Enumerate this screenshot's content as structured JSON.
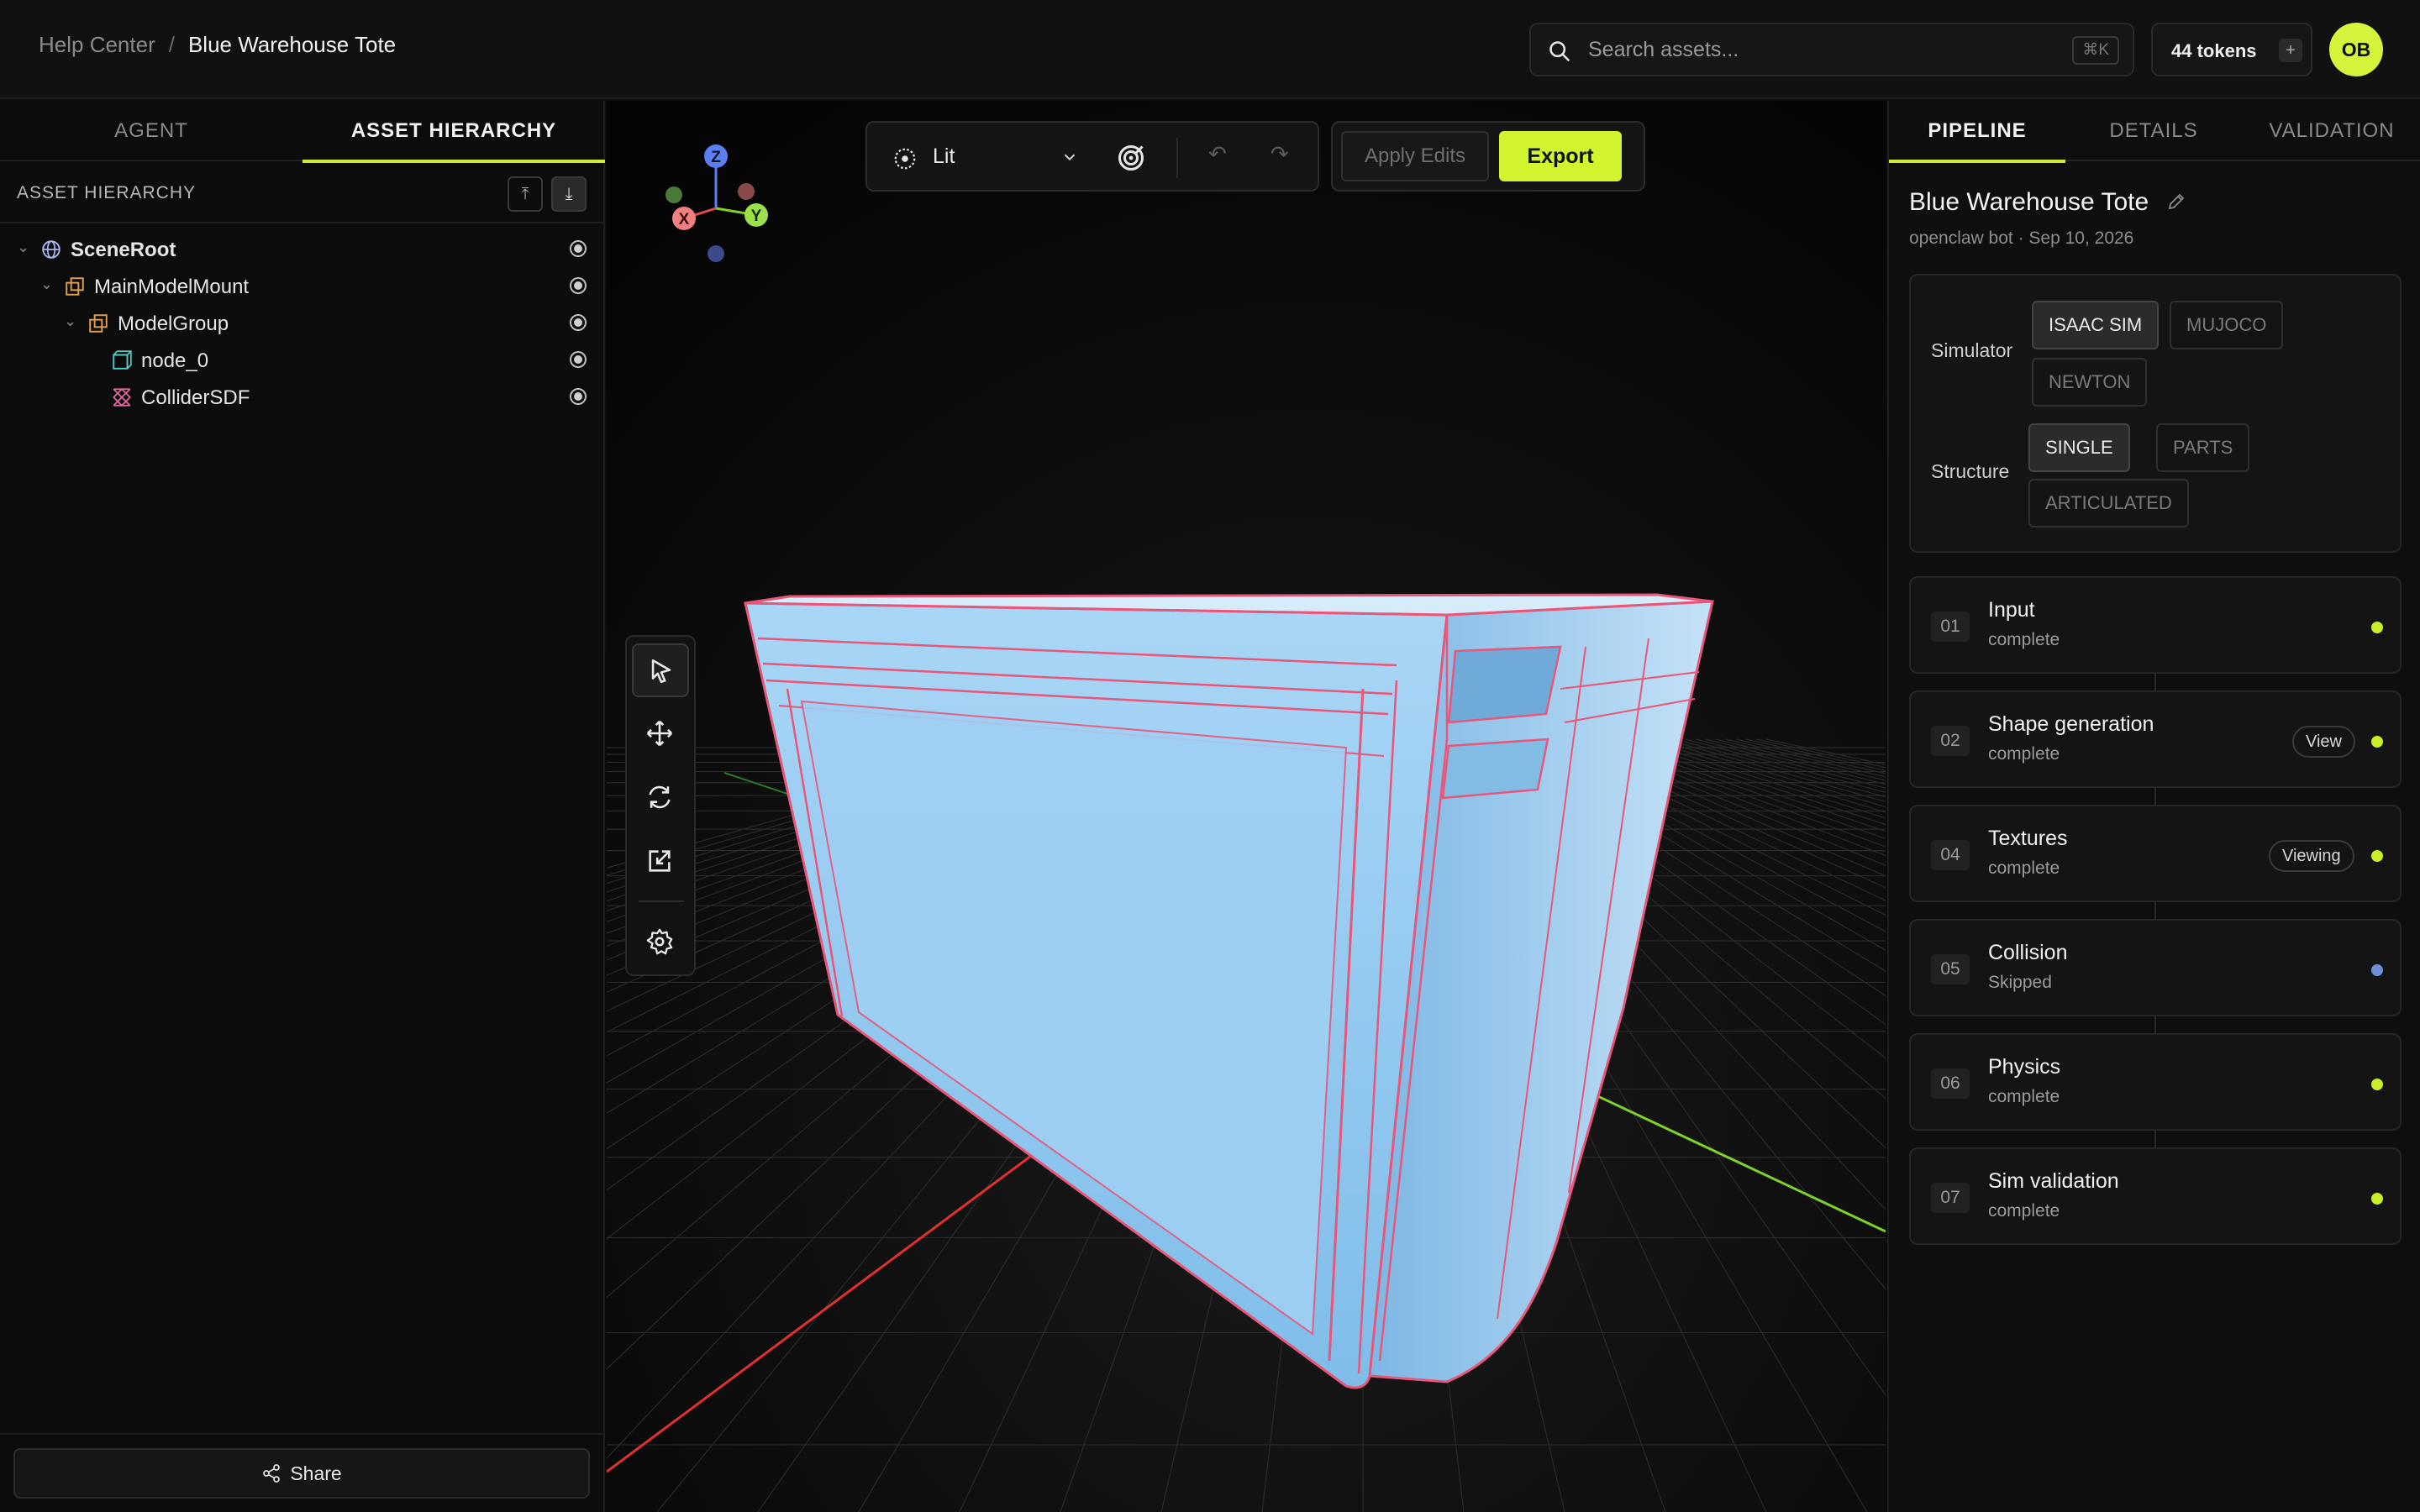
{
  "header": {
    "breadcrumb_root": "Help Center",
    "breadcrumb_sep": "/",
    "breadcrumb_current": "Blue Warehouse Tote",
    "search_placeholder": "Search assets...",
    "search_shortcut": "⌘K",
    "tokens_label": "44 tokens",
    "tokens_add": "+",
    "avatar_initials": "OB"
  },
  "left_panel": {
    "tabs": [
      {
        "label": "AGENT",
        "active": false
      },
      {
        "label": "ASSET HIERARCHY",
        "active": true
      }
    ],
    "section_title": "ASSET HIERARCHY",
    "collapse_all": "⤒",
    "expand_all": "⤓",
    "tree": [
      {
        "label": "SceneRoot",
        "icon": "globe-icon",
        "expanded": true
      },
      {
        "label": "MainModelMount",
        "icon": "mount-icon",
        "expanded": true
      },
      {
        "label": "ModelGroup",
        "icon": "group-icon",
        "expanded": true
      },
      {
        "label": "node_0",
        "icon": "mesh-icon"
      },
      {
        "label": "ColliderSDF",
        "icon": "collider-icon"
      }
    ],
    "share_label": "Share"
  },
  "viewport": {
    "render_mode": "Lit",
    "undo": "↶",
    "redo": "↷",
    "apply_label": "Apply Edits",
    "export_label": "Export",
    "gizmo": {
      "z": "Z",
      "x": "X",
      "y": "Y"
    },
    "tools": [
      "select-icon",
      "move-icon",
      "rotate-icon",
      "scale-icon",
      "settings-icon"
    ],
    "colors": {
      "accent": "#d2f42e",
      "axis_x": "#e0302f",
      "axis_y": "#7fd12a",
      "axis_z": "#5b7ff0",
      "mesh": "#8cc6f2",
      "edges": "#e8577a"
    }
  },
  "right_panel": {
    "tabs": [
      {
        "label": "PIPELINE",
        "active": true
      },
      {
        "label": "DETAILS",
        "active": false
      },
      {
        "label": "VALIDATION",
        "active": false
      }
    ],
    "asset_title": "Blue Warehouse Tote",
    "asset_meta": "openclaw bot · Sep 10, 2026",
    "simulator_label": "Simulator",
    "simulator_options": [
      {
        "label": "ISAAC SIM",
        "selected": true
      },
      {
        "label": "MUJOCO",
        "selected": false
      },
      {
        "label": "NEWTON",
        "selected": false
      }
    ],
    "structure_label": "Structure",
    "structure_options": [
      {
        "label": "SINGLE",
        "selected": true
      },
      {
        "label": "PARTS",
        "selected": false
      },
      {
        "label": "ARTICULATED",
        "selected": false
      }
    ],
    "steps": [
      {
        "num": "01",
        "name": "Input",
        "status": "complete",
        "action": ""
      },
      {
        "num": "02",
        "name": "Shape generation",
        "status": "complete",
        "action": "View"
      },
      {
        "num": "04",
        "name": "Textures",
        "status": "complete",
        "action": "Viewing"
      },
      {
        "num": "05",
        "name": "Collision",
        "status": "Skipped",
        "action": ""
      },
      {
        "num": "06",
        "name": "Physics",
        "status": "complete",
        "action": ""
      },
      {
        "num": "07",
        "name": "Sim validation",
        "status": "complete",
        "action": ""
      }
    ]
  }
}
